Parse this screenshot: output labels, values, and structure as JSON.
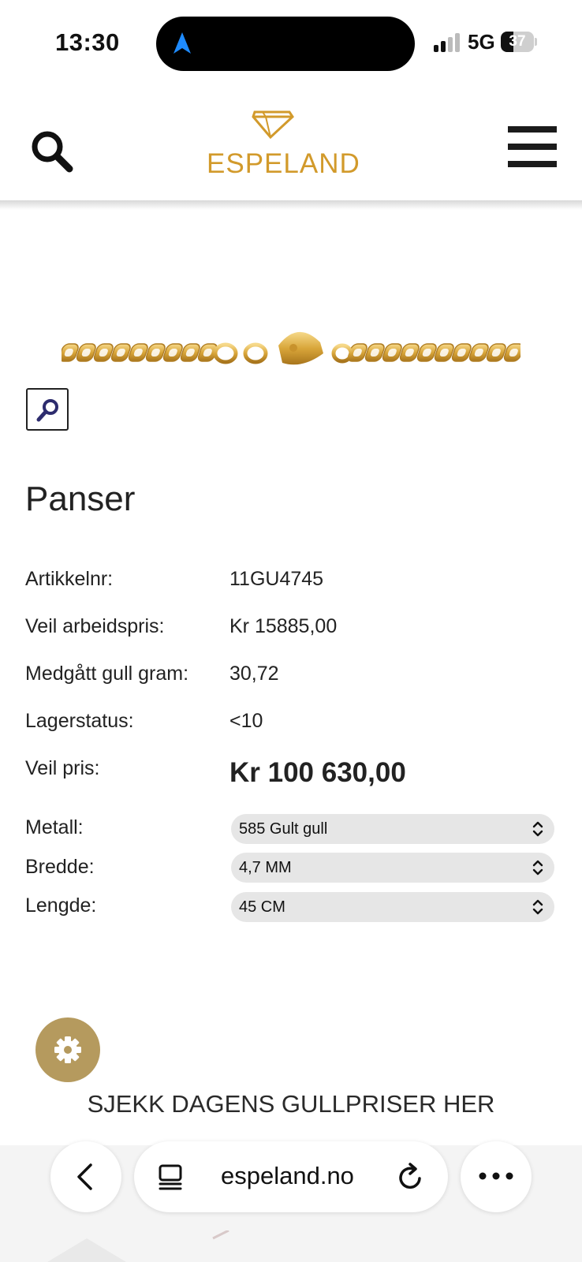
{
  "status_bar": {
    "time": "13:30",
    "network": "5G",
    "battery": "37",
    "battery_level": 0.37
  },
  "header": {
    "logo_text": "ESPELAND",
    "search_icon": "search-icon",
    "menu_icon": "hamburger-menu-icon",
    "brand_color": "#d29a2b"
  },
  "product": {
    "title": "Panser",
    "image_icon": "gold-chain-image",
    "zoom_icon": "magnifier-icon",
    "info": [
      {
        "label": "Artikkelnr:",
        "value": "11GU4745"
      },
      {
        "label": "Veil arbeidspris:",
        "value": "Kr 15885,00"
      },
      {
        "label": "Medgått gull gram:",
        "value": "30,72"
      },
      {
        "label": "Lagerstatus:",
        "value": "<10"
      }
    ],
    "price": {
      "label": "Veil pris:",
      "value": "Kr 100 630,00"
    },
    "options": [
      {
        "label": "Metall:",
        "selected": "585 Gult gull"
      },
      {
        "label": "Bredde:",
        "selected": "4,7 MM"
      },
      {
        "label": "Lengde:",
        "selected": "45 CM"
      }
    ]
  },
  "promo": {
    "gold_price_link": "SJEKK DAGENS GULLPRISER HER",
    "settings_icon": "gear-icon",
    "fab_color": "#b59a5e"
  },
  "browser": {
    "url": "espeland.no",
    "back_icon": "chevron-left-icon",
    "tab_icon": "tab-overview-icon",
    "reload_icon": "reload-icon",
    "more_icon": "more-dots-icon"
  }
}
